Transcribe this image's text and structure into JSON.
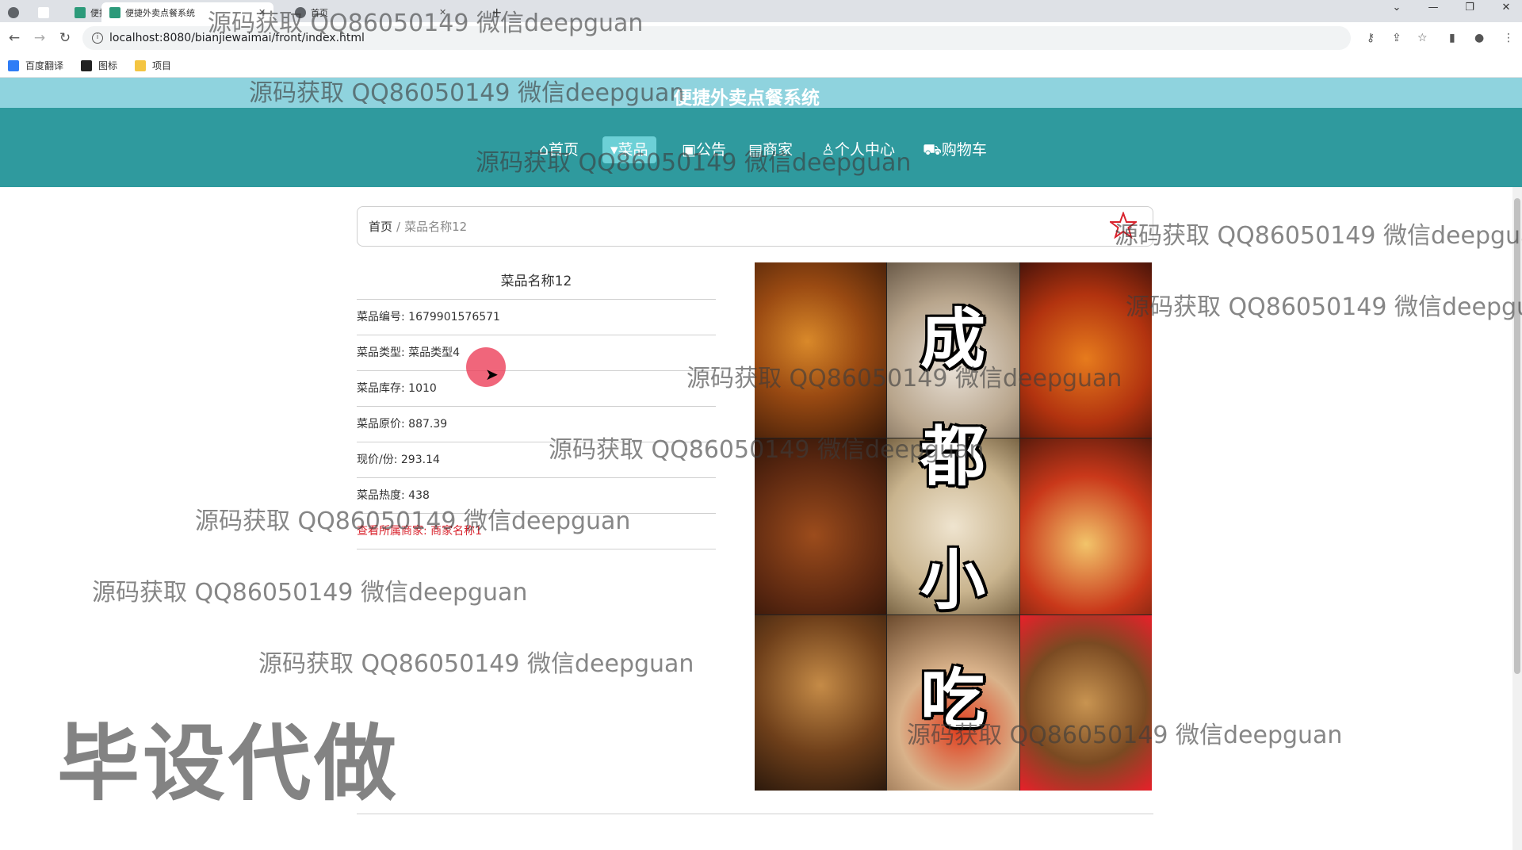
{
  "browser": {
    "tabs": [
      {
        "title": ""
      },
      {
        "title": ""
      },
      {
        "title": "便捷外卖点餐系统"
      },
      {
        "title": "首页"
      }
    ],
    "new_tab_label": "+",
    "url": "localhost:8080/bianjiewaimai/front/index.html",
    "bookmarks": [
      {
        "label": "百度翻译",
        "icon": "baidu-translate-icon",
        "color": "#2f7df6"
      },
      {
        "label": "图标",
        "icon": "image-icon",
        "color": "#222222"
      },
      {
        "label": "项目",
        "icon": "folder-icon",
        "color": "#f4c542"
      }
    ]
  },
  "site": {
    "title": "便捷外卖点餐系统",
    "nav": [
      {
        "label": "⌂首页",
        "active": false
      },
      {
        "label": "▾菜品",
        "active": true
      },
      {
        "label": "▣公告",
        "active": false
      },
      {
        "label": "▤商家",
        "active": false
      },
      {
        "label": "♙个人中心",
        "active": false
      },
      {
        "label": "⛟购物车",
        "active": false
      }
    ],
    "colors": {
      "top_bar": "#8fd3de",
      "nav_bar": "#2f9a9e",
      "nav_active": "#6cd0d6",
      "link_red": "#d9232d"
    }
  },
  "breadcrumb": {
    "home": "首页",
    "separator": "/",
    "current": "菜品名称12"
  },
  "dish": {
    "name": "菜品名称12",
    "rows": [
      {
        "label": "菜品编号: ",
        "value": "1679901576571"
      },
      {
        "label": "菜品类型: ",
        "value": "菜品类型4"
      },
      {
        "label": "菜品库存: ",
        "value": "1010"
      },
      {
        "label": "菜品原价: ",
        "value": "887.39"
      },
      {
        "label": "现价/份: ",
        "value": "293.14"
      },
      {
        "label": "菜品热度: ",
        "value": "438"
      }
    ],
    "merchant_link": "查看所属商家: 商家名称1",
    "image_text": [
      "成",
      "都",
      "小",
      "吃"
    ]
  },
  "watermarks": {
    "line": "源码获取 QQ86050149 微信deepguan",
    "big": "毕设代做"
  }
}
